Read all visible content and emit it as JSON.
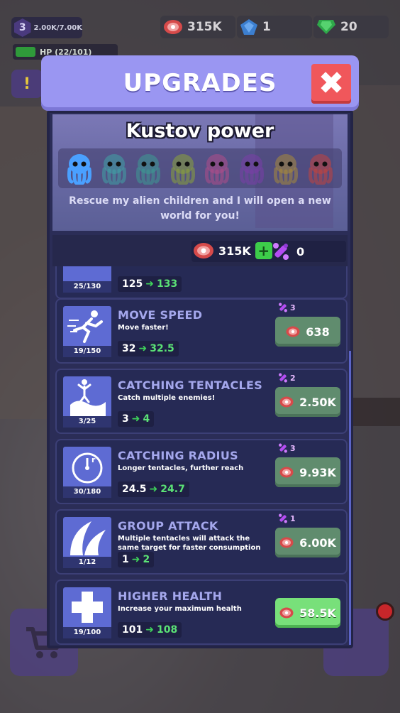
{
  "hud": {
    "level": "3",
    "xp": "2.00K/7.00K",
    "hp": "HP (22/101)",
    "meat": "315K",
    "gems": "1",
    "emeralds": "20"
  },
  "modal": {
    "title": "UPGRADES",
    "close_label": "✖",
    "banner_title": "Kustov power",
    "banner_text": "Rescue my alien children and I will open a new world for you!",
    "alien_colors": [
      "#4aa0ff",
      "#3fa2a6",
      "#3d9b93",
      "#8aa23a",
      "#b04c8a",
      "#7a3ea8",
      "#a88a3a",
      "#c2443e"
    ]
  },
  "currency": {
    "meat": "315K",
    "plus": "+",
    "purple": "0"
  },
  "upgrades": [
    {
      "title": "",
      "desc": "",
      "level": "25/130",
      "from": "125",
      "to": "133",
      "cost": "",
      "price": "",
      "icon": "partial-icon"
    },
    {
      "title": "MOVE SPEED",
      "desc": "Move faster!",
      "level": "19/150",
      "from": "32",
      "to": "32.5",
      "cost": "3",
      "price": "638",
      "icon": "running-icon"
    },
    {
      "title": "CATCHING TENTACLES",
      "desc": "Catch multiple enemies!",
      "level": "3/25",
      "from": "3",
      "to": "4",
      "cost": "2",
      "price": "2.50K",
      "icon": "tentacle-catch-icon"
    },
    {
      "title": "CATCHING RADIUS",
      "desc": "Longer tentacles, further reach",
      "level": "30/180",
      "from": "24.5",
      "to": "24.7",
      "cost": "3",
      "price": "9.93K",
      "icon": "radius-icon"
    },
    {
      "title": "GROUP ATTACK",
      "desc": "Multiple tentacles will attack the same target for faster consumption",
      "level": "1/12",
      "from": "1",
      "to": "2",
      "cost": "1",
      "price": "6.00K",
      "icon": "tentacles-icon"
    },
    {
      "title": "HIGHER HEALTH",
      "desc": "Increase your maximum health",
      "level": "19/100",
      "from": "101",
      "to": "108",
      "cost": "",
      "price": "58.5K",
      "icon": "health-cross-icon"
    }
  ]
}
